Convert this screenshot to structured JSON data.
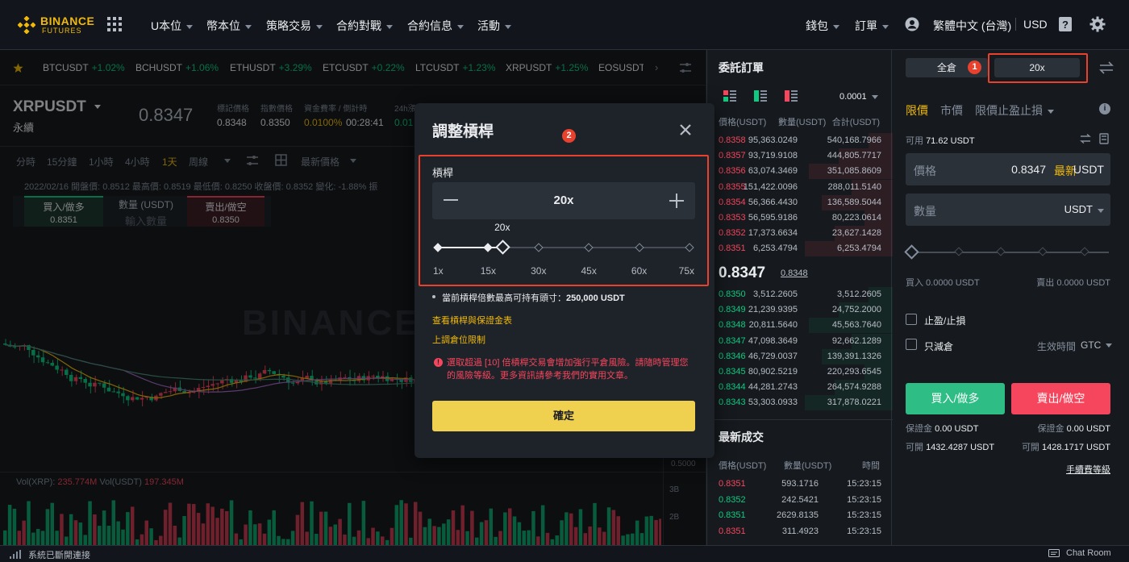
{
  "logo": {
    "line1": "BINANCE",
    "line2": "FUTURES"
  },
  "nav": [
    {
      "label": "U本位"
    },
    {
      "label": "幣本位"
    },
    {
      "label": "策略交易"
    },
    {
      "label": "合約對戰"
    },
    {
      "label": "合約信息"
    },
    {
      "label": "活動"
    }
  ],
  "right_nav": {
    "wallet": "錢包",
    "orders": "訂單",
    "language": "繁體中文 (台灣)",
    "currency": "USD"
  },
  "ticker": [
    {
      "sym": "BTCUSDT",
      "chg": "+1.02%"
    },
    {
      "sym": "BCHUSDT",
      "chg": "+1.06%"
    },
    {
      "sym": "ETHUSDT",
      "chg": "+3.29%"
    },
    {
      "sym": "ETCUSDT",
      "chg": "+0.22%"
    },
    {
      "sym": "LTCUSDT",
      "chg": "+1.23%"
    },
    {
      "sym": "XRPUSDT",
      "chg": "+1.25%"
    },
    {
      "sym": "EOSUSDT",
      "chg": ""
    }
  ],
  "market": {
    "symbol": "XRPUSDT",
    "type": "永續",
    "price": "0.8347",
    "mark_label": "標記價格",
    "mark": "0.8348",
    "index_label": "指數價格",
    "index": "0.8350",
    "funding_label": "資金費率 / 倒計時",
    "funding": "0.0100%",
    "countdown": "00:28:41",
    "h24_label": "24h漲",
    "h24": "0.01"
  },
  "tools": {
    "t1": "分時",
    "t2": "15分鐘",
    "t3": "1小時",
    "t4": "4小時",
    "t5": "1天",
    "t6": "周線",
    "latest": "最新價格"
  },
  "candle_info": "2022/02/16 開盤價: 0.8512 最高價: 0.8519 最低價: 0.8250 收盤價: 0.8352 變化: -1.88% 振",
  "quick": {
    "buy_label": "買入/做多",
    "buy_price": "0.8351",
    "qty_label": "數量 (USDT)",
    "qty_placeholder": "輸入數量",
    "sell_label": "賣出/做空",
    "sell_price": "0.8350"
  },
  "vol_info": {
    "xrp_label": "Vol(XRP):",
    "xrp": "235.774M",
    "usdt_label": "Vol(USDT)",
    "usdt": "197.345M"
  },
  "axis": {
    "p1": "0.5000",
    "v1": "3B",
    "v2": "2B"
  },
  "watermark": "BINANCE",
  "orderbook": {
    "title": "委託訂單",
    "precision": "0.0001",
    "headers": {
      "price": "價格(USDT)",
      "amount": "數量(USDT)",
      "total": "合計(USDT)"
    },
    "asks": [
      {
        "p": "0.8358",
        "a": "95,363.0249",
        "s": "540,168.7966"
      },
      {
        "p": "0.8357",
        "a": "93,719.9108",
        "s": "444,805.7717"
      },
      {
        "p": "0.8356",
        "a": "63,074.3469",
        "s": "351,085.8609"
      },
      {
        "p": "0.8355",
        "a": "151,422.0096",
        "s": "288,011.5140"
      },
      {
        "p": "0.8354",
        "a": "56,366.4430",
        "s": "136,589.5044"
      },
      {
        "p": "0.8353",
        "a": "56,595.9186",
        "s": "80,223.0614"
      },
      {
        "p": "0.8352",
        "a": "17,373.6634",
        "s": "23,627.1428"
      },
      {
        "p": "0.8351",
        "a": "6,253.4794",
        "s": "6,253.4794"
      }
    ],
    "mid": "0.8347",
    "mid_mark": "0.8348",
    "bids": [
      {
        "p": "0.8350",
        "a": "3,512.2605",
        "s": "3,512.2605"
      },
      {
        "p": "0.8349",
        "a": "21,239.9395",
        "s": "24,752.2000"
      },
      {
        "p": "0.8348",
        "a": "20,811.5640",
        "s": "45,563.7640"
      },
      {
        "p": "0.8347",
        "a": "47,098.3649",
        "s": "92,662.1289"
      },
      {
        "p": "0.8346",
        "a": "46,729.0037",
        "s": "139,391.1326"
      },
      {
        "p": "0.8345",
        "a": "80,902.5219",
        "s": "220,293.6545"
      },
      {
        "p": "0.8344",
        "a": "44,281.2743",
        "s": "264,574.9288"
      },
      {
        "p": "0.8343",
        "a": "53,303.0933",
        "s": "317,878.0221"
      }
    ],
    "trades_title": "最新成交",
    "trade_headers": {
      "price": "價格(USDT)",
      "amount": "數量(USDT)",
      "time": "時間"
    },
    "trades": [
      {
        "p": "0.8351",
        "a": "593.1716",
        "t": "15:23:15",
        "side": "sell"
      },
      {
        "p": "0.8352",
        "a": "242.5421",
        "t": "15:23:15",
        "side": "buy"
      },
      {
        "p": "0.8351",
        "a": "2629.8135",
        "t": "15:23:15",
        "side": "buy"
      },
      {
        "p": "0.8351",
        "a": "311.4923",
        "t": "15:23:15",
        "side": "sell"
      }
    ]
  },
  "order": {
    "cross": "全倉",
    "leverage": "20x",
    "tabs": {
      "limit": "限價",
      "market": "市價",
      "stop": "限價止盈止損"
    },
    "avail_label": "可用",
    "avail": "71.62 USDT",
    "price_label": "價格",
    "price_val": "0.8347",
    "latest": "最新",
    "price_unit": "USDT",
    "qty_label": "數量",
    "qty_unit": "USDT",
    "buy_amt": "買入 0.0000 USDT",
    "sell_amt": "賣出 0.0000 USDT",
    "tpsl": "止盈/止損",
    "reduce": "只減倉",
    "tif_label": "生效時間",
    "tif": "GTC",
    "buy_btn": "買入/做多",
    "sell_btn": "賣出/做空",
    "margin_buy_label": "保證金",
    "margin_buy": "0.00 USDT",
    "margin_sell_label": "保證金",
    "margin_sell": "0.00 USDT",
    "max_buy_label": "可開",
    "max_buy": "1432.4287 USDT",
    "max_sell_label": "可開",
    "max_sell": "1428.1717 USDT",
    "fee_link": "手續費等級"
  },
  "status": {
    "text": "系統已斷開連接",
    "chat": "Chat Room"
  },
  "badges": {
    "one": "1",
    "two": "2"
  },
  "modal": {
    "title": "調整槓桿",
    "lev_label": "槓桿",
    "lev_value": "20x",
    "tooltip": "20x",
    "marks": [
      "1x",
      "15x",
      "30x",
      "45x",
      "60x",
      "75x"
    ],
    "lev_level": 0.2568,
    "max_pos_prefix": "當前槓桿倍數最高可持有頭寸：",
    "max_pos": "250,000 USDT",
    "link1": "查看槓桿與保證金表",
    "link2": "上調倉位限制",
    "warning": "選取超過 [10] 倍槓桿交易會增加強行平倉風險。請隨時管理您的風險等級。更多資訊請參考我們的實用文章。",
    "confirm": "確定"
  },
  "colors": {
    "up": "#0ecb81",
    "down": "#f6465d",
    "accent": "#f0b90b",
    "highlight": "#e8412d"
  }
}
